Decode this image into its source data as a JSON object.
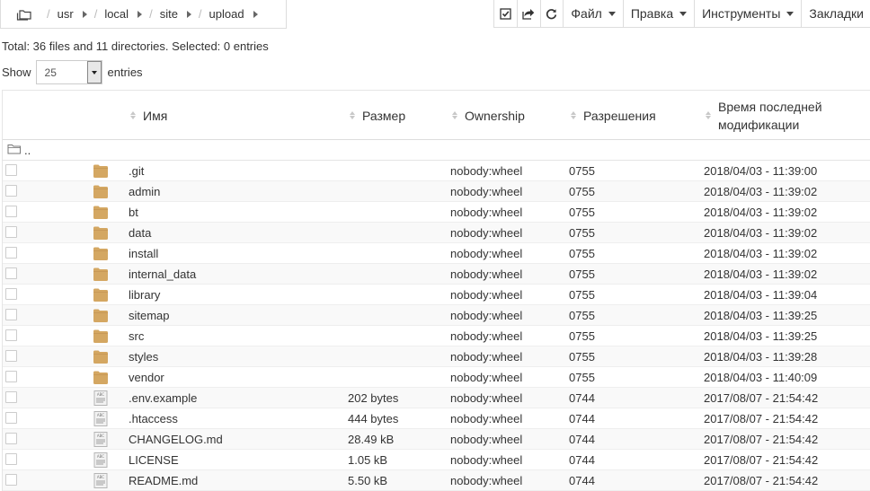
{
  "breadcrumb": {
    "items": [
      "usr",
      "local",
      "site",
      "upload"
    ],
    "separator": "/"
  },
  "toolbar": {
    "icons": [
      "checkbox-icon",
      "share-icon",
      "refresh-icon"
    ],
    "menus": [
      "Файл",
      "Правка",
      "Инструменты",
      "Закладки"
    ]
  },
  "summary": "Total: 36 files and 11 directories. Selected: 0 entries",
  "show": {
    "label_before": "Show",
    "value": "25",
    "label_after": "entries"
  },
  "table": {
    "headers": {
      "name": "Имя",
      "size": "Размер",
      "owner": "Ownership",
      "perms": "Разрешения",
      "modified": "Время последней модификации"
    },
    "parent_label": "..",
    "rows": [
      {
        "type": "folder",
        "name": ".git",
        "size": "",
        "owner": "nobody:wheel",
        "perms": "0755",
        "modified": "2018/04/03 - 11:39:00"
      },
      {
        "type": "folder",
        "name": "admin",
        "size": "",
        "owner": "nobody:wheel",
        "perms": "0755",
        "modified": "2018/04/03 - 11:39:02"
      },
      {
        "type": "folder",
        "name": "bt",
        "size": "",
        "owner": "nobody:wheel",
        "perms": "0755",
        "modified": "2018/04/03 - 11:39:02"
      },
      {
        "type": "folder",
        "name": "data",
        "size": "",
        "owner": "nobody:wheel",
        "perms": "0755",
        "modified": "2018/04/03 - 11:39:02"
      },
      {
        "type": "folder",
        "name": "install",
        "size": "",
        "owner": "nobody:wheel",
        "perms": "0755",
        "modified": "2018/04/03 - 11:39:02"
      },
      {
        "type": "folder",
        "name": "internal_data",
        "size": "",
        "owner": "nobody:wheel",
        "perms": "0755",
        "modified": "2018/04/03 - 11:39:02"
      },
      {
        "type": "folder",
        "name": "library",
        "size": "",
        "owner": "nobody:wheel",
        "perms": "0755",
        "modified": "2018/04/03 - 11:39:04"
      },
      {
        "type": "folder",
        "name": "sitemap",
        "size": "",
        "owner": "nobody:wheel",
        "perms": "0755",
        "modified": "2018/04/03 - 11:39:25"
      },
      {
        "type": "folder",
        "name": "src",
        "size": "",
        "owner": "nobody:wheel",
        "perms": "0755",
        "modified": "2018/04/03 - 11:39:25"
      },
      {
        "type": "folder",
        "name": "styles",
        "size": "",
        "owner": "nobody:wheel",
        "perms": "0755",
        "modified": "2018/04/03 - 11:39:28"
      },
      {
        "type": "folder",
        "name": "vendor",
        "size": "",
        "owner": "nobody:wheel",
        "perms": "0755",
        "modified": "2018/04/03 - 11:40:09"
      },
      {
        "type": "file",
        "name": ".env.example",
        "size": "202 bytes",
        "owner": "nobody:wheel",
        "perms": "0744",
        "modified": "2017/08/07 - 21:54:42"
      },
      {
        "type": "file",
        "name": ".htaccess",
        "size": "444 bytes",
        "owner": "nobody:wheel",
        "perms": "0744",
        "modified": "2017/08/07 - 21:54:42"
      },
      {
        "type": "file",
        "name": "CHANGELOG.md",
        "size": "28.49 kB",
        "owner": "nobody:wheel",
        "perms": "0744",
        "modified": "2017/08/07 - 21:54:42"
      },
      {
        "type": "file",
        "name": "LICENSE",
        "size": "1.05 kB",
        "owner": "nobody:wheel",
        "perms": "0744",
        "modified": "2017/08/07 - 21:54:42"
      },
      {
        "type": "file",
        "name": "README.md",
        "size": "5.50 kB",
        "owner": "nobody:wheel",
        "perms": "0744",
        "modified": "2017/08/07 - 21:54:42"
      }
    ]
  },
  "colors": {
    "folder": "#d4a762",
    "border": "#dddddd",
    "row_alt": "#f9f9f9",
    "text": "#333333"
  }
}
